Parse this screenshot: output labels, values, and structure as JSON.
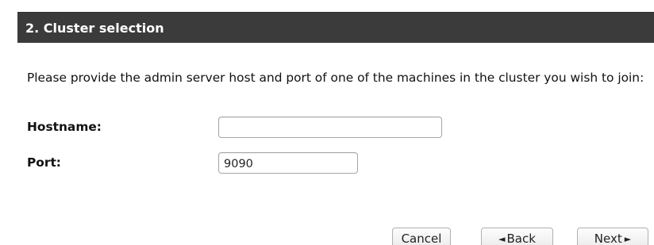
{
  "section": {
    "title": "2. Cluster selection"
  },
  "intro": {
    "text": "Please provide the admin server host and port of one of the machines in the cluster you wish to join:"
  },
  "form": {
    "hostname_label": "Hostname:",
    "hostname_value": "",
    "port_label": "Port:",
    "port_value": "9090"
  },
  "buttons": {
    "cancel_label": "Cancel",
    "back_label": "Back",
    "back_icon": "triangle-left-icon",
    "next_label": "Next",
    "next_icon": "triangle-right-icon"
  },
  "colors": {
    "header_bg": "#3b3b3b",
    "header_text": "#ffffff"
  }
}
